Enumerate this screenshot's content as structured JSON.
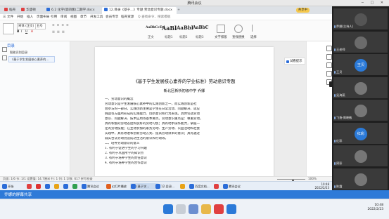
{
  "meeting": {
    "title": "腾讯会议",
    "window_controls": "─ □ ✕"
  },
  "tabs": [
    {
      "label": "稻壳",
      "color": "#e04040"
    },
    {
      "label": "华盛顿",
      "color": "#e04040"
    },
    {
      "label": "6.2 化学(第四版)二期学.docx",
      "color": "#2b6cd8"
    },
    {
      "label": "12.目录《基于...》专题 劳动意识专题.docx",
      "color": "#2b6cd8"
    }
  ],
  "user_chip": "共享中",
  "menu": [
    "三 文件",
    "开始",
    "插入",
    "页面布局",
    "引用",
    "审阅",
    "视图",
    "章节",
    "开发工具",
    "会员专享",
    "稻壳资源",
    "Q 查找命令、搜索模板"
  ],
  "ribbon": {
    "font": "宋体 (正文)",
    "size": "五号",
    "styles": [
      "AaBbCcDd",
      "AaBl",
      "AaBbI",
      "AaBbC"
    ],
    "style_names": [
      "正文",
      "标题1",
      "标题2",
      "标题3"
    ],
    "actions": [
      "文字排版",
      "查找替换",
      "选择"
    ]
  },
  "nav": {
    "title": "目录",
    "items": [
      "智能识别目录",
      "《基于学生发展核心素养的..."
    ]
  },
  "doc": {
    "title": "《基于学生发展核心素养的学业标准》劳动意识专题",
    "subtitle": "新北区新桥初级中学          乔娜",
    "lines": [
      "一、劳动意识的概念",
      "    劳动意识是学生发展核心素养中的实践创新之一，而实践创新是社",
      "会参与的一部分。实践创新主要是学生在日常活动、问题解决、适应",
      "挑战等方面所形成的实践能力、创新意识和行为表现。具体包括劳动",
      "意识、问题解决、技术应用等基本要点。劳动意识重点是：尊重劳动，",
      "具有积极的劳动态度和良好的劳动习惯；具有动手操作能力，掌握一",
      "定的劳动技能；在主动参加的家务劳动、生产劳动、公益活动和社会",
      "实践中，具有改进和创新劳动方式、提高劳动效率的意识；具有通过",
      "诚实合法劳动创造成功生活的意识和行动等。",
      "二、培养劳动意识的意义",
      "    1. 有利于促进学生的学习兴趣",
      "    2. 有利于巩固所学的知识点",
      "    3. 有利于培养学生的责任意识",
      "    4. 有利于培养学生的合作意识"
    ]
  },
  "chat_popup": "试看提示",
  "tooltip": "正在讲话: 乔娜; 王老师",
  "status": {
    "left": "页面: 1/6  节: 1/1  设置值: 14.7厘米  行: 1  列: 1  字数: 617  拼写检查",
    "zoom": "100%",
    "zoom_level": 0.55
  },
  "remote_taskbar": [
    {
      "label": "开始",
      "color": "#2b6cd8",
      "active": false
    },
    {
      "label": "",
      "color": "#e04040",
      "active": false
    },
    {
      "label": "",
      "color": "#d33",
      "active": false
    },
    {
      "label": "",
      "color": "#2b6cd8",
      "active": false
    },
    {
      "label": "",
      "color": "#e8a317",
      "active": false
    },
    {
      "label": "",
      "color": "#2b6cd8",
      "active": false
    },
    {
      "label": "",
      "color": "#30a050",
      "active": false
    },
    {
      "label": "腾讯会议",
      "color": "#2b6cd8",
      "active": false
    },
    {
      "label": "幻灯片播放",
      "color": "#e06020",
      "active": false
    },
    {
      "label": "(基于学...",
      "color": "#2b6cd8",
      "active": true
    },
    {
      "label": "12.目录...",
      "color": "#2b6cd8",
      "active": false
    },
    {
      "label": "",
      "color": "#e8a317",
      "active": false
    },
    {
      "label": "百度文档...",
      "color": "#2b6cd8",
      "active": false
    },
    {
      "label": "",
      "color": "#e04040",
      "active": false
    },
    {
      "label": "腾讯会议",
      "color": "#2b6cd8",
      "active": false
    }
  ],
  "remote_clock": {
    "time": "10:48",
    "date": "2022/2/23"
  },
  "participants": [
    {
      "name": "乔娜(主持人)",
      "avatar": "",
      "color": "#555"
    },
    {
      "name": "王老师",
      "avatar": "",
      "color": "#6b6b6b"
    },
    {
      "name": "王贝",
      "avatar": "王贝",
      "color": "#2b7ad8"
    },
    {
      "name": "吴海燕",
      "avatar": "",
      "color": "#777"
    },
    {
      "name": "飞扬·周晓敏",
      "avatar": "",
      "color": "#777"
    },
    {
      "name": "红彩",
      "avatar": "红彩",
      "color": "#2b7ad8"
    },
    {
      "name": "周彩",
      "avatar": "",
      "color": "#777"
    },
    {
      "name": "陈霞",
      "avatar": "",
      "color": "#777"
    }
  ],
  "meeting_bar": "乔娜的屏幕共享",
  "win_clock": {
    "time": "10:48",
    "date": "2022/2/23"
  }
}
